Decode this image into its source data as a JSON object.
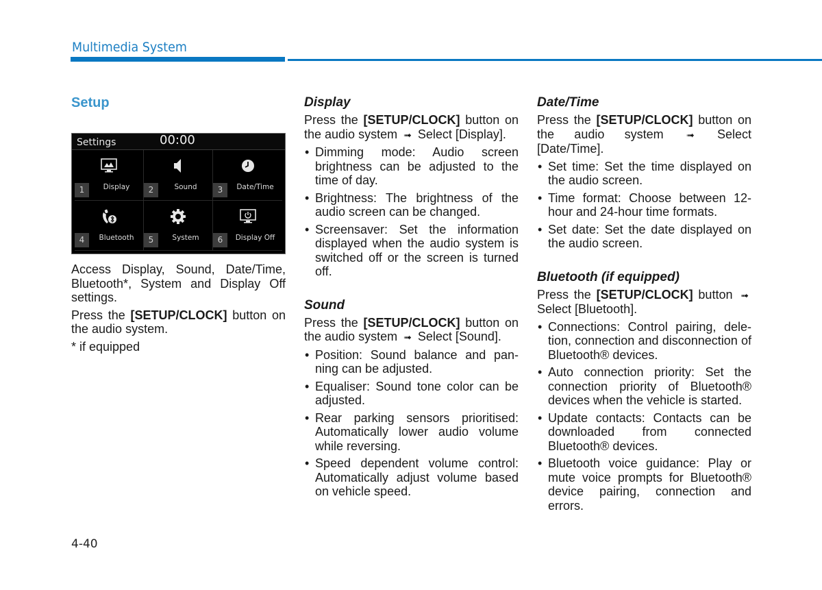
{
  "header": {
    "title": "Multimedia System"
  },
  "setup": {
    "title": "Setup",
    "screen": {
      "title": "Settings",
      "clock": "00:00",
      "tiles": [
        {
          "num": "1",
          "label": "Display",
          "icon": "display-icon"
        },
        {
          "num": "2",
          "label": "Sound",
          "icon": "speaker-icon"
        },
        {
          "num": "3",
          "label": "Date/Time",
          "icon": "clock-icon"
        },
        {
          "num": "4",
          "label": "Bluetooth",
          "icon": "bluetooth-phone-icon"
        },
        {
          "num": "5",
          "label": "System",
          "icon": "gear-icon"
        },
        {
          "num": "6",
          "label": "Display Off",
          "icon": "display-power-icon"
        }
      ]
    },
    "description": "Access Display, Sound, Date/Time, Bluetooth*, System and Display Off settings.",
    "press_prefix": "Press the",
    "press_button": "[SETUP/CLOCK]",
    "press_suffix": "button on the audio system.",
    "footnote": "* if equipped"
  },
  "display": {
    "title": "Display",
    "press_prefix": "Press the",
    "press_button": "[SETUP/CLOCK]",
    "press_middle": "button on the audio system",
    "arrow": "➟",
    "press_suffix": "Select [Display].",
    "bullets": [
      "Dimming mode: Audio screen brightness can be adjusted to the time of day.",
      "Brightness: The brightness of the audio screen can be changed.",
      "Screensaver: Set the information displayed when the audio system is switched off or the screen is turned off."
    ]
  },
  "sound": {
    "title": "Sound",
    "press_prefix": "Press the",
    "press_button": "[SETUP/CLOCK]",
    "press_middle": "button on the audio system",
    "arrow": "➟",
    "press_suffix": "Select [Sound].",
    "bullets": [
      "Position: Sound balance and pan­ning can be adjusted.",
      "Equaliser: Sound tone color can be adjusted.",
      "Rear parking sensors prioritised: Automatically lower audio volume while reversing.",
      "Speed dependent volume control: Automatically adjust volume based on vehicle speed."
    ]
  },
  "datetime": {
    "title": "Date/Time",
    "press_prefix": "Press the",
    "press_button": "[SETUP/CLOCK]",
    "press_middle": "button on the audio system",
    "arrow": "➟",
    "press_suffix": "Select [Date/Time].",
    "bullets": [
      "Set time: Set the time displayed on the audio screen.",
      "Time format: Choose between 12-hour and 24-hour time formats.",
      "Set date: Set the date displayed on the audio screen."
    ]
  },
  "bluetooth": {
    "title": "Bluetooth (if equipped)",
    "press_prefix": "Press the",
    "press_button": "[SETUP/CLOCK]",
    "press_middle": "button",
    "arrow": "➟",
    "press_suffix": "Select [Bluetooth].",
    "bullets": [
      "Connections: Control pairing, dele­tion, connection and disconnection of Bluetooth® devices.",
      "Auto connection priority: Set the connection priority of Bluetooth® devices when the vehicle is started.",
      "Update contacts: Contacts can be downloaded from connected Bluetooth® devices.",
      "Bluetooth voice guidance: Play or mute voice prompts for Bluetooth® device pairing, connection and errors."
    ]
  },
  "footer": {
    "page_number": "4-40"
  },
  "colors": {
    "brand_blue": "#0a78c2",
    "section_title": "#3a95cc"
  }
}
